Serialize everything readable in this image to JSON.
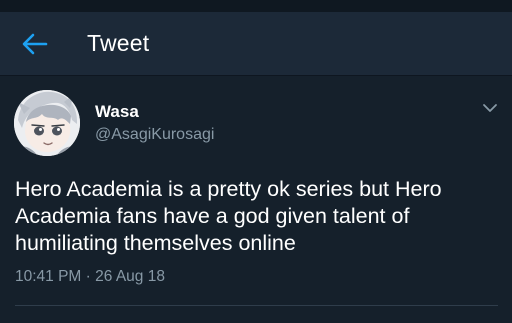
{
  "header": {
    "title": "Tweet",
    "back_icon": "arrow-left-icon"
  },
  "tweet": {
    "display_name": "Wasa",
    "handle": "@AsagiKurosagi",
    "text": "Hero Academia is a pretty ok series but Hero Academia fans have a god given talent of humiliating themselves online",
    "time": "10:41 PM",
    "separator": "·",
    "date": "26 Aug 18",
    "menu_icon": "chevron-down-icon"
  },
  "colors": {
    "background": "#15202b",
    "header_background": "#1c2938",
    "accent": "#1da1f2",
    "secondary_text": "#8899a6",
    "primary_text": "#ffffff"
  }
}
